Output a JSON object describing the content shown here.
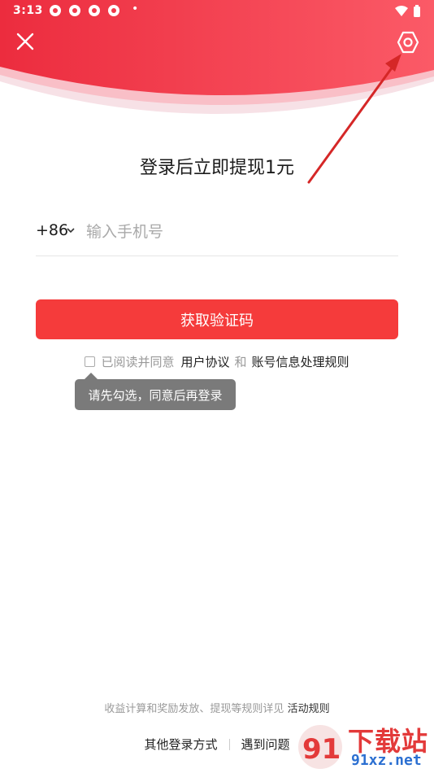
{
  "status_bar": {
    "time": "3:13",
    "dot": "•"
  },
  "title": "登录后立即提现1元",
  "phone": {
    "country_code": "+86",
    "placeholder": "输入手机号"
  },
  "get_code_button": "获取验证码",
  "agreement": {
    "prefix": "已阅读并同意",
    "user_agreement": "用户协议",
    "and": "和",
    "account_rules": "账号信息处理规则"
  },
  "tooltip": "请先勾选，同意后再登录",
  "footer": {
    "rules_text": "收益计算和奖励发放、提现等规则详见",
    "rules_link": "活动规则",
    "other_login": "其他登录方式",
    "problem": "遇到问题"
  },
  "watermark": {
    "big": "下载站",
    "small": "91xz.net",
    "logo": "91"
  },
  "colors": {
    "brand_red": "#f53b3b",
    "header_red": "#f0384a"
  },
  "icons": [
    "close-icon",
    "settings-icon",
    "chevron-down-icon",
    "wifi-icon",
    "battery-icon"
  ]
}
